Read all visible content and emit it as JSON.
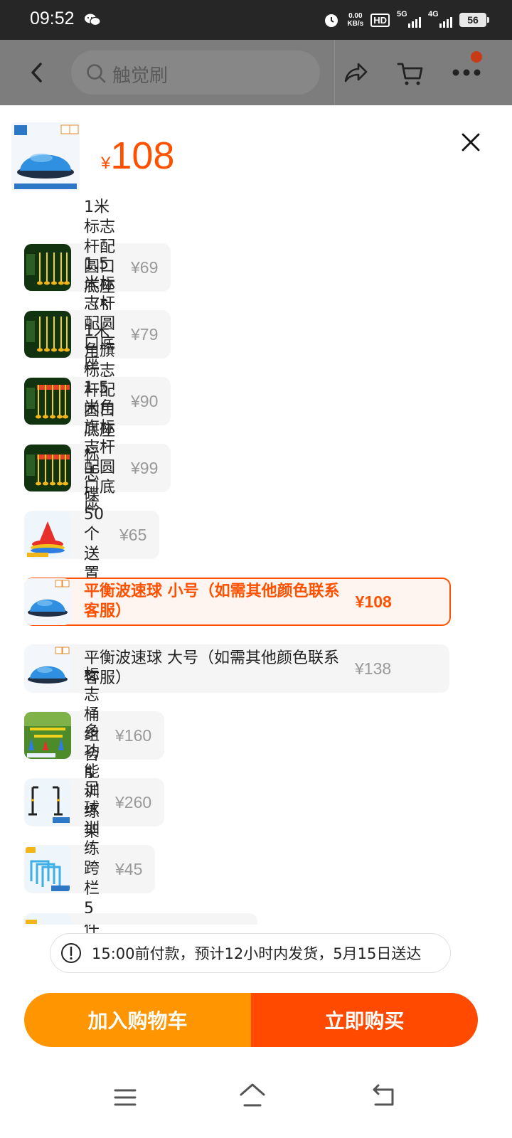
{
  "status_bar": {
    "time": "09:52",
    "net_speed_value": "0.00",
    "net_speed_unit": "KB/s",
    "hd": "HD",
    "sig1": "5G",
    "sig2": "4G",
    "battery": "56",
    "icons": [
      "wechat-icon",
      "alarm-icon",
      "signal-icon",
      "battery-icon"
    ]
  },
  "nav": {
    "search_placeholder": "触觉刷",
    "icons": [
      "back-icon",
      "search-icon",
      "share-icon",
      "cart-icon",
      "more-icon"
    ]
  },
  "sheet": {
    "current_price_symbol": "¥",
    "current_price": "108",
    "close_icon": "close-icon"
  },
  "options": [
    {
      "label": "1米标志杆配圆口底座（5组）",
      "price": "¥69",
      "thumb": "pole"
    },
    {
      "label": "1.5米标志杆配圆口底座（5组）",
      "price": "¥79",
      "thumb": "pole"
    },
    {
      "label": "1米角旗标志杆配圆口底座（5组）",
      "price": "¥90",
      "thumb": "flag"
    },
    {
      "label": "1.5米角旗标志杆配圆口底座（5组）",
      "price": "¥99",
      "thumb": "flag"
    },
    {
      "label": "标志碟50个送置物架",
      "price": "¥65",
      "thumb": "cones"
    },
    {
      "label_line1": "平衡波速球 小号（如需其他颜色联系",
      "label_line2": "客服）",
      "price": "¥108",
      "thumb": "ball",
      "selected": true
    },
    {
      "label_line1": "平衡波速球 大号（如需其他颜色联系",
      "label_line2": "客服）",
      "price": "¥138",
      "thumb": "ball"
    },
    {
      "label": "标志桶组合5组",
      "price": "¥160",
      "thumb": "buckets"
    },
    {
      "label": "多功能训练架1副",
      "price": "¥260",
      "thumb": "rack"
    },
    {
      "label": "足球训练跨栏5件套",
      "price": "¥45",
      "thumb": "hurdle"
    }
  ],
  "notice": {
    "text": "15:00前付款，预计12小时内发货，5月15日送达",
    "icon": "info-icon"
  },
  "actions": {
    "add_to_cart": "加入购物车",
    "buy_now": "立即购买"
  },
  "colors": {
    "accent": "#ff5000",
    "cart_button": "#ff9500",
    "buy_button": "#ff4a00"
  },
  "system_nav": {
    "icons": [
      "menu-icon",
      "home-icon",
      "back-nav-icon"
    ]
  }
}
